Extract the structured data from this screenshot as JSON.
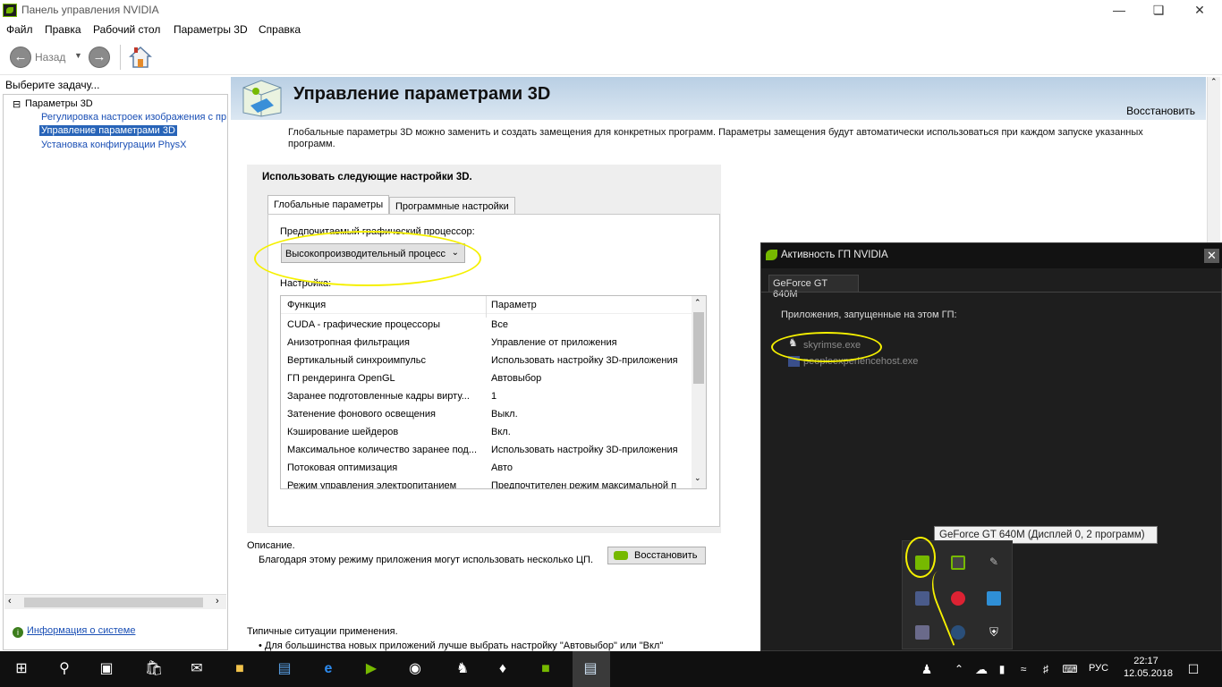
{
  "window": {
    "title": "Панель управления NVIDIA"
  },
  "menu": [
    "Файл",
    "Правка",
    "Рабочий стол",
    "Параметры 3D",
    "Справка"
  ],
  "toolbar": {
    "back_label": "Назад"
  },
  "left": {
    "task_label": "Выберите задачу...",
    "tree_root": "Параметры 3D",
    "items": [
      "Регулировка настроек изображения с пр",
      "Управление параметрами 3D",
      "Установка конфигурации PhysX"
    ],
    "sysinfo": "Информация о системе"
  },
  "main": {
    "title": "Управление параметрами 3D",
    "restore": "Восстановить",
    "description": "Глобальные параметры 3D можно заменить и создать замещения для конкретных программ. Параметры замещения будут автоматически использоваться при каждом запуске указанных программ.",
    "settings_header": "Использовать следующие настройки 3D.",
    "tabs": [
      "Глобальные параметры",
      "Программные настройки"
    ],
    "gpu_label": "Предпочитаемый графический процессор:",
    "gpu_value": "Высокопроизводительный процесс",
    "settings_label": "Настройка:",
    "columns": [
      "Функция",
      "Параметр"
    ],
    "rows": [
      [
        "CUDA - графические процессоры",
        "Все"
      ],
      [
        "Анизотропная фильтрация",
        "Управление от приложения"
      ],
      [
        "Вертикальный синхроимпульс",
        "Использовать настройку 3D-приложения"
      ],
      [
        "ГП рендеринга OpenGL",
        "Автовыбор"
      ],
      [
        "Заранее подготовленные кадры вирту...",
        "1"
      ],
      [
        "Затенение фонового освещения",
        "Выкл."
      ],
      [
        "Кэширование шейдеров",
        "Вкл."
      ],
      [
        "Максимальное количество заранее под...",
        "Использовать настройку 3D-приложения"
      ],
      [
        "Потоковая оптимизация",
        "Авто"
      ],
      [
        "Режим управления электропитанием",
        "Предпочтителен режим максимальной п"
      ]
    ],
    "restore_button": "Восстановить",
    "desc_label": "Описание.",
    "desc_text": "Благодаря этому режиму приложения могут использовать несколько ЦП.",
    "typical_label": "Типичные ситуации применения.",
    "typical_text": "• Для большинства новых приложений лучше выбрать настройку \"Автовыбор\" или \"Вкл\""
  },
  "gpu_activity": {
    "title": "Активность ГП NVIDIA",
    "tab": "GeForce GT 640M",
    "apps_label": "Приложения, запущенные на этом ГП:",
    "apps": [
      "skyrimse.exe",
      "peopleexperiencehost.exe"
    ]
  },
  "tooltip": "GeForce GT 640M (Дисплей 0, 2 программ)",
  "taskbar": {
    "lang": "РУС",
    "time": "22:17",
    "date": "12.05.2018"
  },
  "colors": {
    "nvidia_green": "#76b900",
    "highlight": "#f5f000",
    "banner": "#c6d8ea"
  }
}
